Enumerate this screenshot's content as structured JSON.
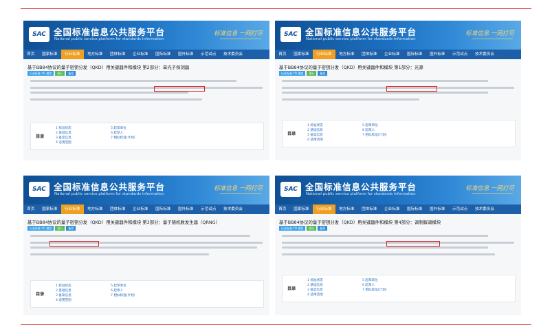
{
  "site": {
    "logo": "SAC",
    "title": "全国标准信息公共服务平台",
    "subtitle": "National public service platform  for standards information",
    "slogan": "标准信息 一网打尽"
  },
  "nav": [
    "首页",
    "国家标准",
    "行业标准",
    "地方标准",
    "团体标准",
    "企业标准",
    "国际标准",
    "国外标准",
    "示范试点",
    "技术委员会"
  ],
  "toc_label": "目录",
  "toc_col1": [
    "1 标准状态",
    "2 基础信息",
    "3 备案信息",
    "4 适用范围"
  ],
  "toc_col2": [
    "5 起草单位",
    "6 起草人",
    "7 相似标准(计划)"
  ],
  "tags": [
    "行业标准-YD 通信",
    "现行",
    "备案"
  ],
  "panels": [
    {
      "title": "基于BB84协议的量子密钥分发（QKD）用关键器件和模块 第2部分：单光子探测器",
      "active_nav": 2
    },
    {
      "title": "基于BB84协议的量子密钥分发（QKD）用关键器件和模块 第1部分：光源",
      "active_nav": 2
    },
    {
      "title": "基于BB84协议的量子密钥分发（QKD）用关键器件和模块 第3部分：量子随机数发生器（QRNG）",
      "active_nav": 2
    },
    {
      "title": "基于BB84协议的量子密钥分发（QKD）用关键器件和模块 第4部分：调制解调模块",
      "active_nav": 2
    }
  ]
}
